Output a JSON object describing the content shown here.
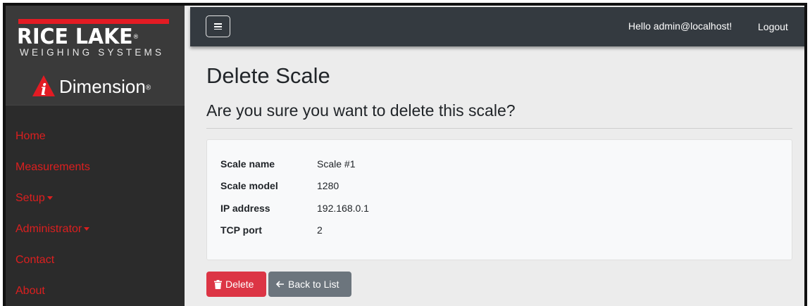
{
  "brand": {
    "name": "RICE LAKE",
    "tagline": "WEIGHING SYSTEMS",
    "product": "Dimension"
  },
  "sidebar": {
    "items": [
      {
        "label": "Home"
      },
      {
        "label": "Measurements"
      },
      {
        "label": "Setup"
      },
      {
        "label": "Administrator"
      },
      {
        "label": "Contact"
      },
      {
        "label": "About"
      }
    ]
  },
  "header": {
    "greeting": "Hello admin@localhost!",
    "logout_label": "Logout"
  },
  "main": {
    "title": "Delete Scale",
    "subtitle": "Are you sure you want to delete this scale?",
    "details": [
      {
        "label": "Scale name",
        "value": "Scale #1"
      },
      {
        "label": "Scale model",
        "value": "1280"
      },
      {
        "label": "IP address",
        "value": "192.168.0.1"
      },
      {
        "label": "TCP port",
        "value": "2"
      }
    ],
    "delete_label": "Delete",
    "back_label": "Back to List"
  },
  "colors": {
    "accent_red": "#dc1f1f",
    "danger": "#dc3545",
    "secondary": "#6c757d",
    "navbar": "#343a40"
  },
  "icons": [
    "menu-icon",
    "trash-icon",
    "arrow-left-icon",
    "caret-down-icon"
  ]
}
